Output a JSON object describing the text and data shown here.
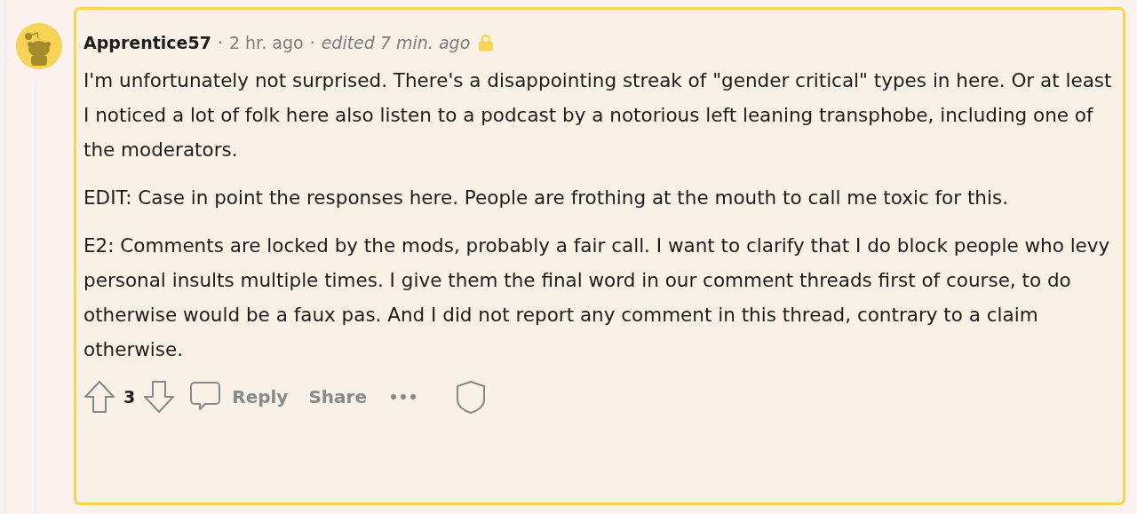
{
  "comment": {
    "author": "Apprentice57",
    "separator_1": "·",
    "posted": "2 hr. ago",
    "separator_2": "·",
    "edited": "edited 7 min. ago",
    "locked": true,
    "highlighted": true,
    "paragraphs": [
      "I'm unfortunately not surprised. There's a disappointing streak of \"gender critical\" types in here. Or at least I noticed a lot of folk here also listen to a podcast by a notorious left leaning transphobe, including one of the moderators.",
      "EDIT: Case in point the responses here. People are frothing at the mouth to call me toxic for this.",
      "E2: Comments are locked by the mods, probably a fair call. I want to clarify that I do block people who levy personal insults multiple times. I give them the final word in our comment threads first of course, to do otherwise would be a faux pas. And I did not report any comment in this thread, contrary to a claim otherwise."
    ],
    "score": "3",
    "actions": [
      {
        "kind": "reply",
        "label": "Reply"
      },
      {
        "kind": "share",
        "label": "Share"
      },
      {
        "kind": "more"
      },
      {
        "kind": "mod"
      }
    ]
  }
}
